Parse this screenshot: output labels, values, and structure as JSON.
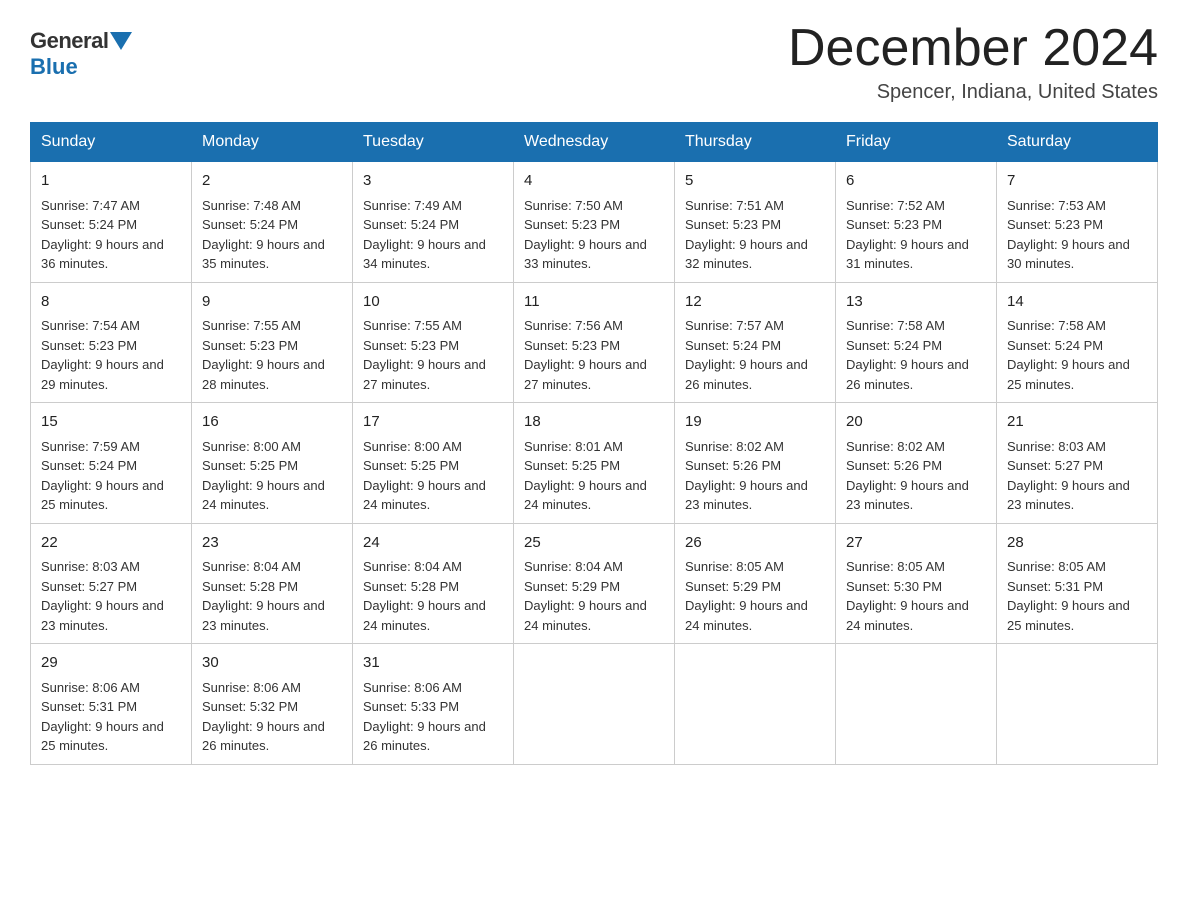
{
  "logo": {
    "general": "General",
    "blue": "Blue"
  },
  "title": "December 2024",
  "location": "Spencer, Indiana, United States",
  "days_of_week": [
    "Sunday",
    "Monday",
    "Tuesday",
    "Wednesday",
    "Thursday",
    "Friday",
    "Saturday"
  ],
  "weeks": [
    [
      {
        "day": "1",
        "sunrise": "7:47 AM",
        "sunset": "5:24 PM",
        "daylight": "9 hours and 36 minutes."
      },
      {
        "day": "2",
        "sunrise": "7:48 AM",
        "sunset": "5:24 PM",
        "daylight": "9 hours and 35 minutes."
      },
      {
        "day": "3",
        "sunrise": "7:49 AM",
        "sunset": "5:24 PM",
        "daylight": "9 hours and 34 minutes."
      },
      {
        "day": "4",
        "sunrise": "7:50 AM",
        "sunset": "5:23 PM",
        "daylight": "9 hours and 33 minutes."
      },
      {
        "day": "5",
        "sunrise": "7:51 AM",
        "sunset": "5:23 PM",
        "daylight": "9 hours and 32 minutes."
      },
      {
        "day": "6",
        "sunrise": "7:52 AM",
        "sunset": "5:23 PM",
        "daylight": "9 hours and 31 minutes."
      },
      {
        "day": "7",
        "sunrise": "7:53 AM",
        "sunset": "5:23 PM",
        "daylight": "9 hours and 30 minutes."
      }
    ],
    [
      {
        "day": "8",
        "sunrise": "7:54 AM",
        "sunset": "5:23 PM",
        "daylight": "9 hours and 29 minutes."
      },
      {
        "day": "9",
        "sunrise": "7:55 AM",
        "sunset": "5:23 PM",
        "daylight": "9 hours and 28 minutes."
      },
      {
        "day": "10",
        "sunrise": "7:55 AM",
        "sunset": "5:23 PM",
        "daylight": "9 hours and 27 minutes."
      },
      {
        "day": "11",
        "sunrise": "7:56 AM",
        "sunset": "5:23 PM",
        "daylight": "9 hours and 27 minutes."
      },
      {
        "day": "12",
        "sunrise": "7:57 AM",
        "sunset": "5:24 PM",
        "daylight": "9 hours and 26 minutes."
      },
      {
        "day": "13",
        "sunrise": "7:58 AM",
        "sunset": "5:24 PM",
        "daylight": "9 hours and 26 minutes."
      },
      {
        "day": "14",
        "sunrise": "7:58 AM",
        "sunset": "5:24 PM",
        "daylight": "9 hours and 25 minutes."
      }
    ],
    [
      {
        "day": "15",
        "sunrise": "7:59 AM",
        "sunset": "5:24 PM",
        "daylight": "9 hours and 25 minutes."
      },
      {
        "day": "16",
        "sunrise": "8:00 AM",
        "sunset": "5:25 PM",
        "daylight": "9 hours and 24 minutes."
      },
      {
        "day": "17",
        "sunrise": "8:00 AM",
        "sunset": "5:25 PM",
        "daylight": "9 hours and 24 minutes."
      },
      {
        "day": "18",
        "sunrise": "8:01 AM",
        "sunset": "5:25 PM",
        "daylight": "9 hours and 24 minutes."
      },
      {
        "day": "19",
        "sunrise": "8:02 AM",
        "sunset": "5:26 PM",
        "daylight": "9 hours and 23 minutes."
      },
      {
        "day": "20",
        "sunrise": "8:02 AM",
        "sunset": "5:26 PM",
        "daylight": "9 hours and 23 minutes."
      },
      {
        "day": "21",
        "sunrise": "8:03 AM",
        "sunset": "5:27 PM",
        "daylight": "9 hours and 23 minutes."
      }
    ],
    [
      {
        "day": "22",
        "sunrise": "8:03 AM",
        "sunset": "5:27 PM",
        "daylight": "9 hours and 23 minutes."
      },
      {
        "day": "23",
        "sunrise": "8:04 AM",
        "sunset": "5:28 PM",
        "daylight": "9 hours and 23 minutes."
      },
      {
        "day": "24",
        "sunrise": "8:04 AM",
        "sunset": "5:28 PM",
        "daylight": "9 hours and 24 minutes."
      },
      {
        "day": "25",
        "sunrise": "8:04 AM",
        "sunset": "5:29 PM",
        "daylight": "9 hours and 24 minutes."
      },
      {
        "day": "26",
        "sunrise": "8:05 AM",
        "sunset": "5:29 PM",
        "daylight": "9 hours and 24 minutes."
      },
      {
        "day": "27",
        "sunrise": "8:05 AM",
        "sunset": "5:30 PM",
        "daylight": "9 hours and 24 minutes."
      },
      {
        "day": "28",
        "sunrise": "8:05 AM",
        "sunset": "5:31 PM",
        "daylight": "9 hours and 25 minutes."
      }
    ],
    [
      {
        "day": "29",
        "sunrise": "8:06 AM",
        "sunset": "5:31 PM",
        "daylight": "9 hours and 25 minutes."
      },
      {
        "day": "30",
        "sunrise": "8:06 AM",
        "sunset": "5:32 PM",
        "daylight": "9 hours and 26 minutes."
      },
      {
        "day": "31",
        "sunrise": "8:06 AM",
        "sunset": "5:33 PM",
        "daylight": "9 hours and 26 minutes."
      },
      null,
      null,
      null,
      null
    ]
  ]
}
